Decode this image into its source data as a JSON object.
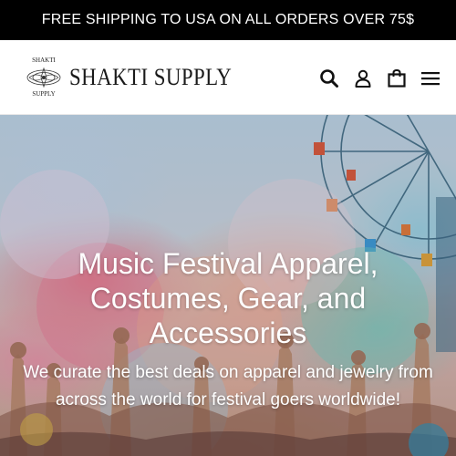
{
  "announcement": {
    "text": "FREE SHIPPING TO USA ON ALL ORDERS OVER 75$"
  },
  "header": {
    "logo": {
      "top_text": "SHAKTI",
      "bottom_text": "SUPPLY",
      "wordmark": "SHAKTI SUPPLY"
    },
    "icons": [
      "search-icon",
      "account-icon",
      "cart-icon",
      "menu-icon"
    ]
  },
  "hero": {
    "title": "Music Festival Apparel, Costumes, Gear, and Accessories",
    "subtitle": "We curate the best deals on apparel and jewelry from across the world for festival goers worldwide!"
  },
  "colors": {
    "announcement_bg": "#000000",
    "text_dark": "#1a1a1a",
    "hero_text": "#ffffff"
  }
}
